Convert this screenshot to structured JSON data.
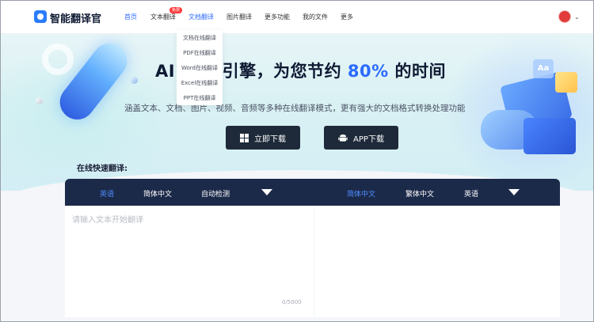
{
  "nav": {
    "logo_text": "智能翻译官",
    "items": [
      {
        "label": "首页",
        "state": "active"
      },
      {
        "label": "文本翻译",
        "badge": "免费"
      },
      {
        "label": "文档翻译",
        "state": "open"
      },
      {
        "label": "图片翻译"
      },
      {
        "label": "更多功能"
      },
      {
        "label": "我的文件"
      },
      {
        "label": "更多"
      }
    ],
    "avatar_icon": "user-avatar",
    "caret": "⌄"
  },
  "doc_dropdown": {
    "items": [
      "文档在线翻译",
      "PDF在线翻译",
      "Word在线翻译",
      "Excel在线翻译",
      "PPT在线翻译"
    ]
  },
  "hero": {
    "title_prefix": "AI",
    "title_partial": "译引擎，为您节约",
    "title_pct": "80%",
    "title_suffix": "的时间",
    "subtitle_left": "涵盖文本、文",
    "subtitle_mid": "档、图",
    "subtitle_right": "片、视频、音频等多种在线翻译模式，更有强大的文档格式转换处理功能",
    "btn_windows": "立即下载",
    "btn_app": "APP下载"
  },
  "translator": {
    "label": "在线快速翻译:",
    "source_langs": [
      "英语",
      "简体中文",
      "自动检测"
    ],
    "source_active": "英语",
    "target_langs": [
      "简体中文",
      "繁体中文",
      "英语"
    ],
    "target_active": "简体中文",
    "input_placeholder": "请输入文本开始翻译",
    "counter": "0/5000"
  },
  "colors": {
    "accent": "#2b6bff",
    "lang_bar": "#1c2a4a",
    "badge": "#ff3b3b",
    "download_button": "#1e2a3a"
  }
}
